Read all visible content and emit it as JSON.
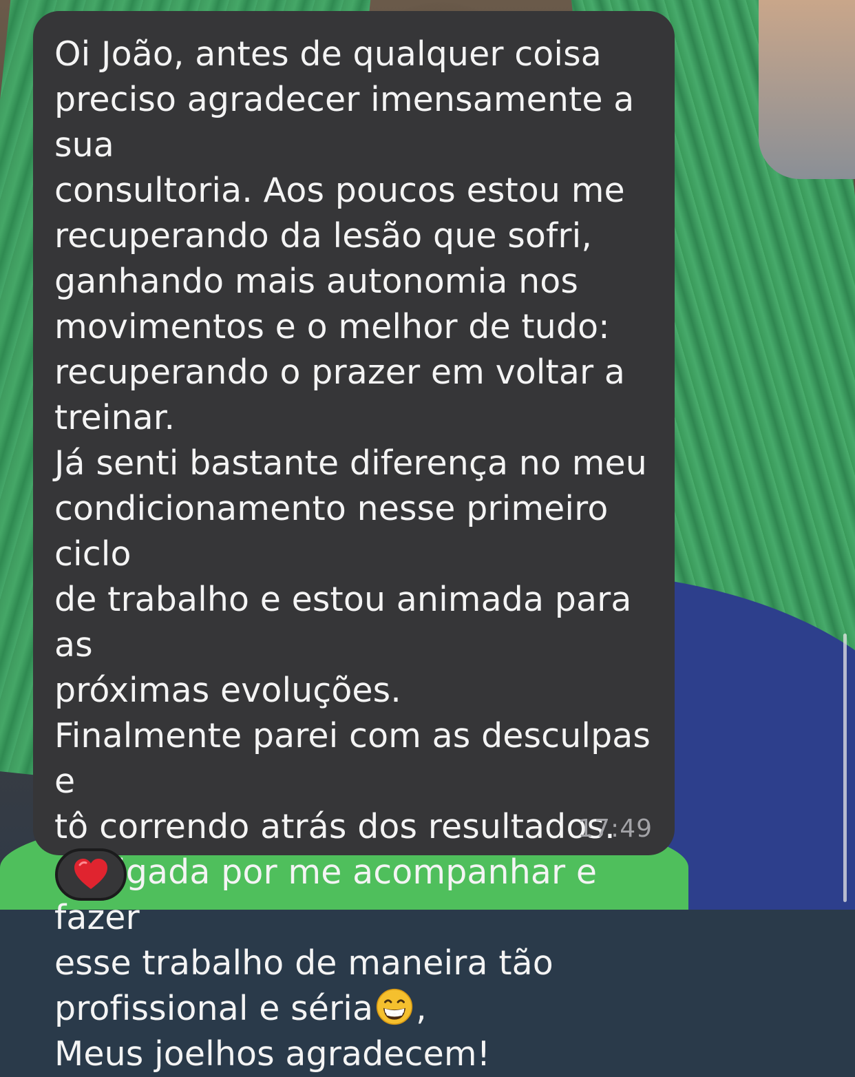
{
  "message": {
    "lines": [
      "Oi João, antes de qualquer coisa",
      "preciso agradecer imensamente a sua",
      "consultoria. Aos poucos estou me",
      "recuperando da lesão que sofri,",
      "ganhando mais autonomia nos",
      "movimentos e o melhor de tudo:",
      "recuperando o prazer em voltar a",
      "treinar.",
      "Já senti bastante diferença no meu",
      "condicionamento nesse primeiro ciclo",
      "de trabalho e estou animada para as",
      "próximas evoluções.",
      "Finalmente parei com as desculpas e",
      "tô correndo atrás dos resultados.",
      "Obrigada por me acompanhar e fazer",
      "esse trabalho de maneira tão",
      "profissional e séria",
      "Meus joelhos agradecem!"
    ],
    "emoji_after_line_17": "grinning-face-with-smiling-eyes",
    "emoji_trailing_text": ",",
    "timestamp": "17:49",
    "bubble_color": "#363638",
    "text_color": "#f4f4f4"
  },
  "reaction": {
    "icon": "red-heart",
    "color": "#e0242f"
  },
  "wallpaper": {
    "towel_color": "#45a767",
    "shirt_color": "#2d3f8c"
  }
}
